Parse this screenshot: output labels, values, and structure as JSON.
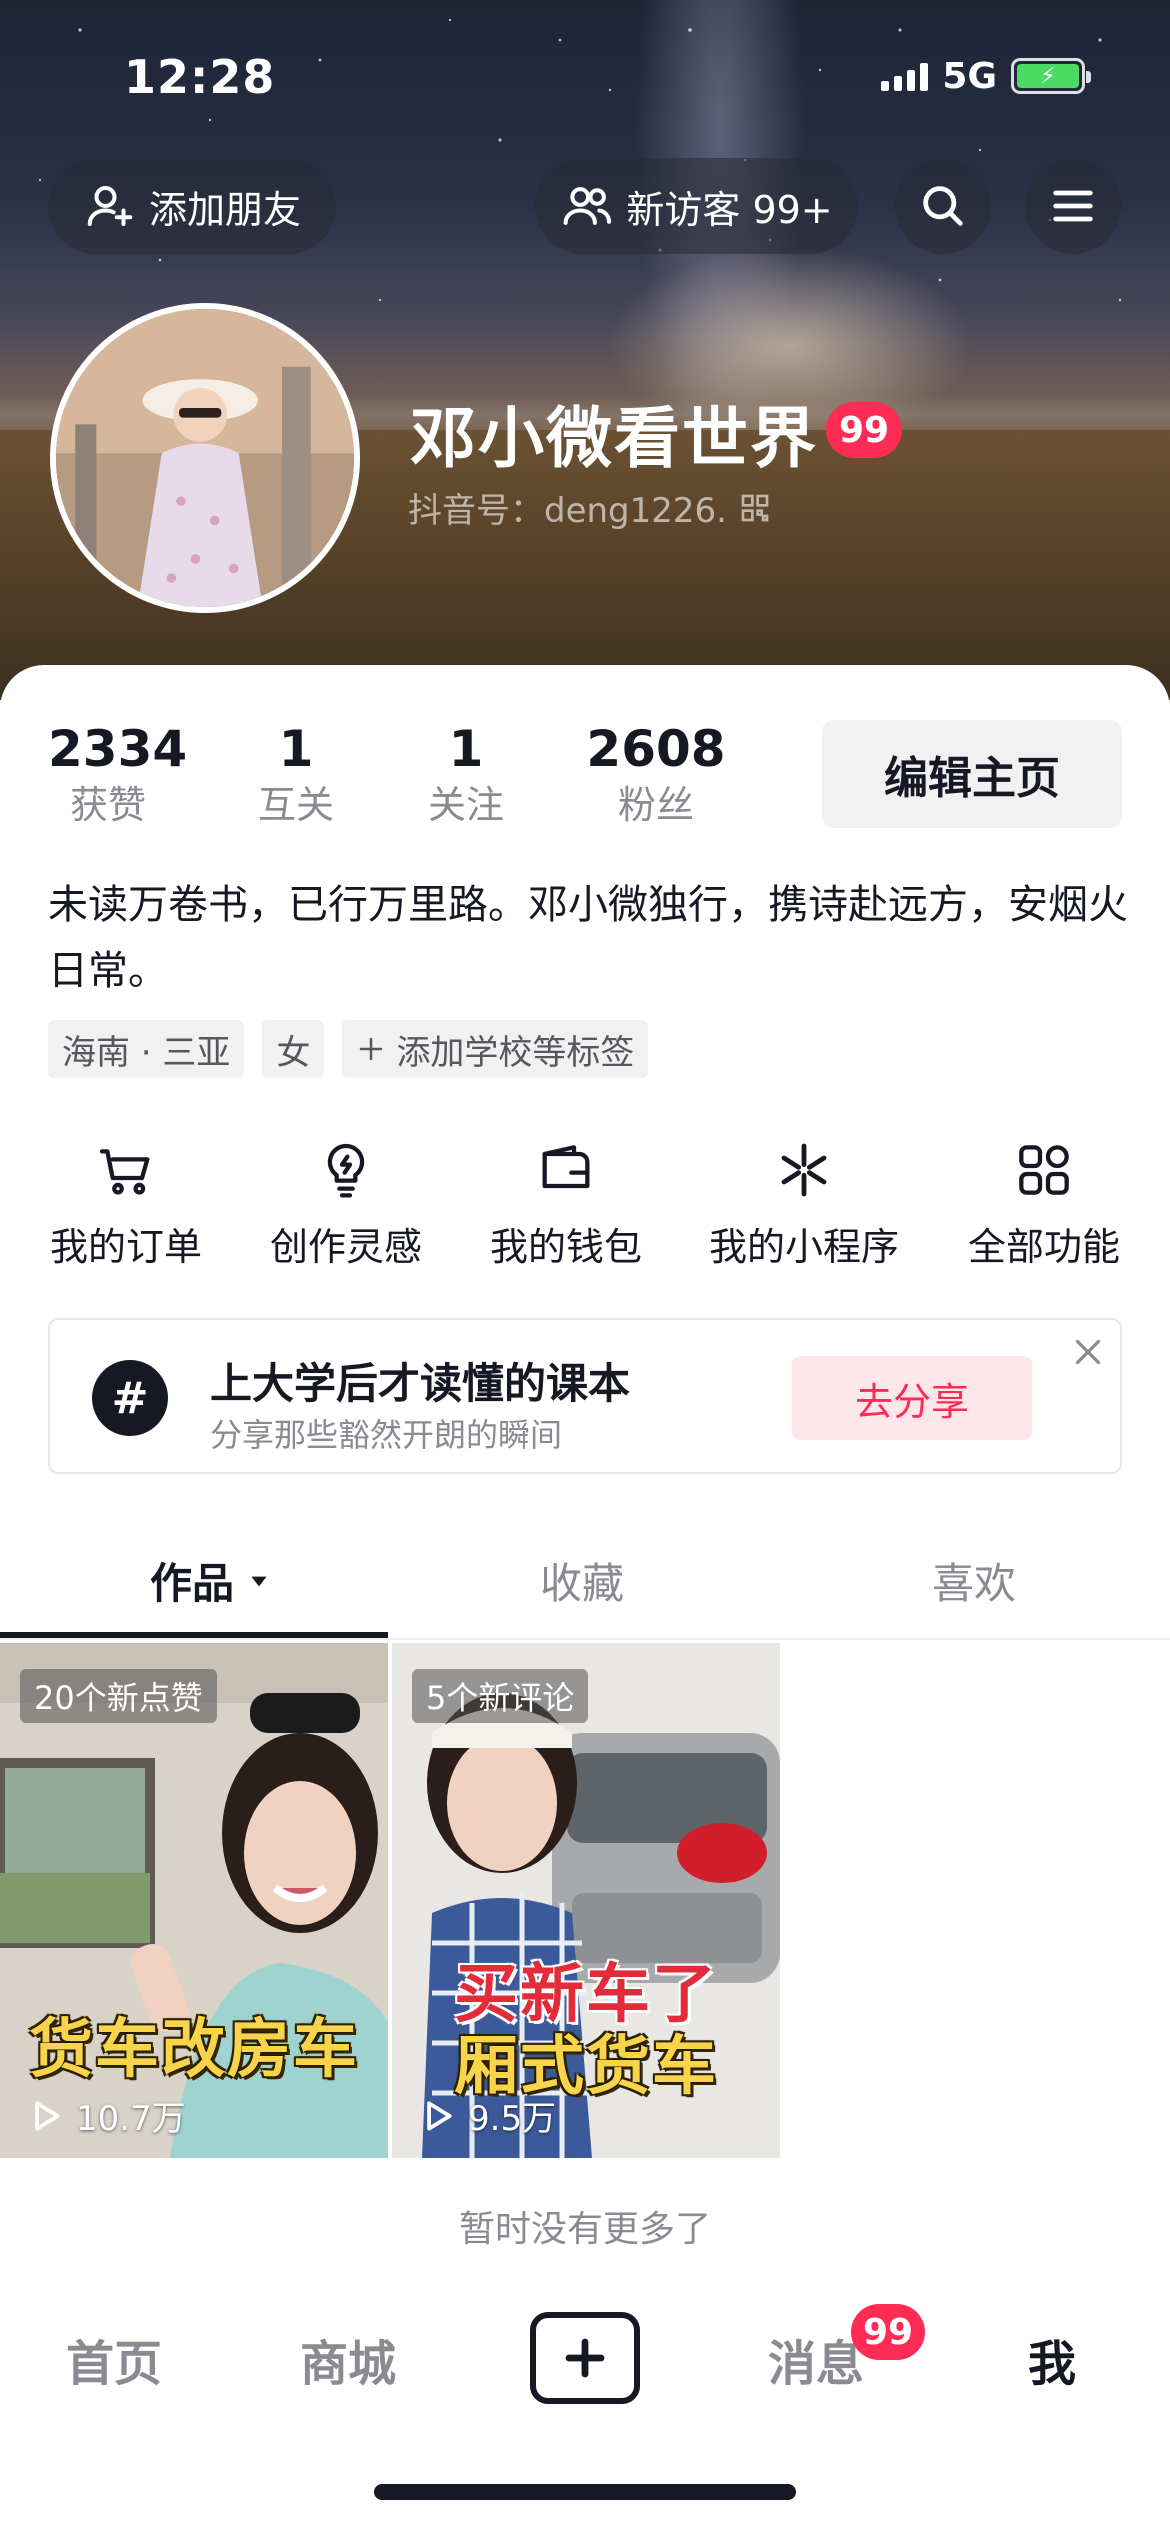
{
  "status_bar": {
    "time": "12:28",
    "network": "5G"
  },
  "header": {
    "add_friend_label": "添加朋友",
    "new_visitor_label": "新访客 99+",
    "name": "邓小微看世界",
    "name_badge": "99",
    "douyin_id": "抖音号：deng1226."
  },
  "stats": [
    {
      "value": "2334",
      "label": "获赞"
    },
    {
      "value": "1",
      "label": "互关"
    },
    {
      "value": "1",
      "label": "关注"
    },
    {
      "value": "2608",
      "label": "粉丝"
    }
  ],
  "edit_profile_label": "编辑主页",
  "bio": "未读万卷书，已行万里路。邓小微独行，携诗赴远方，安烟火日常。",
  "tags": [
    "海南 · 三亚",
    "女",
    "添加学校等标签"
  ],
  "features": [
    {
      "label": "我的订单",
      "icon": "cart-icon"
    },
    {
      "label": "创作灵感",
      "icon": "lightbulb-icon"
    },
    {
      "label": "我的钱包",
      "icon": "wallet-icon"
    },
    {
      "label": "我的小程序",
      "icon": "mini-program-icon"
    },
    {
      "label": "全部功能",
      "icon": "grid-icon"
    }
  ],
  "promo": {
    "title": "上大学后才读懂的课本",
    "subtitle": "分享那些豁然开朗的瞬间",
    "button": "去分享"
  },
  "tabs": [
    "作品",
    "收藏",
    "喜欢"
  ],
  "videos": [
    {
      "badge": "20个新点赞",
      "caption": "货车改房车",
      "plays": "10.7万"
    },
    {
      "badge": "5个新评论",
      "caption_line1": "买新车了",
      "caption_line2": "厢式货车",
      "plays": "9.5万"
    }
  ],
  "no_more_text": "暂时没有更多了",
  "bottom_nav": {
    "home": "首页",
    "mall": "商城",
    "messages": "消息",
    "messages_badge": "99",
    "me": "我"
  },
  "colors": {
    "accent": "#fe2c55",
    "text": "#161823",
    "muted": "#8a8b91"
  }
}
